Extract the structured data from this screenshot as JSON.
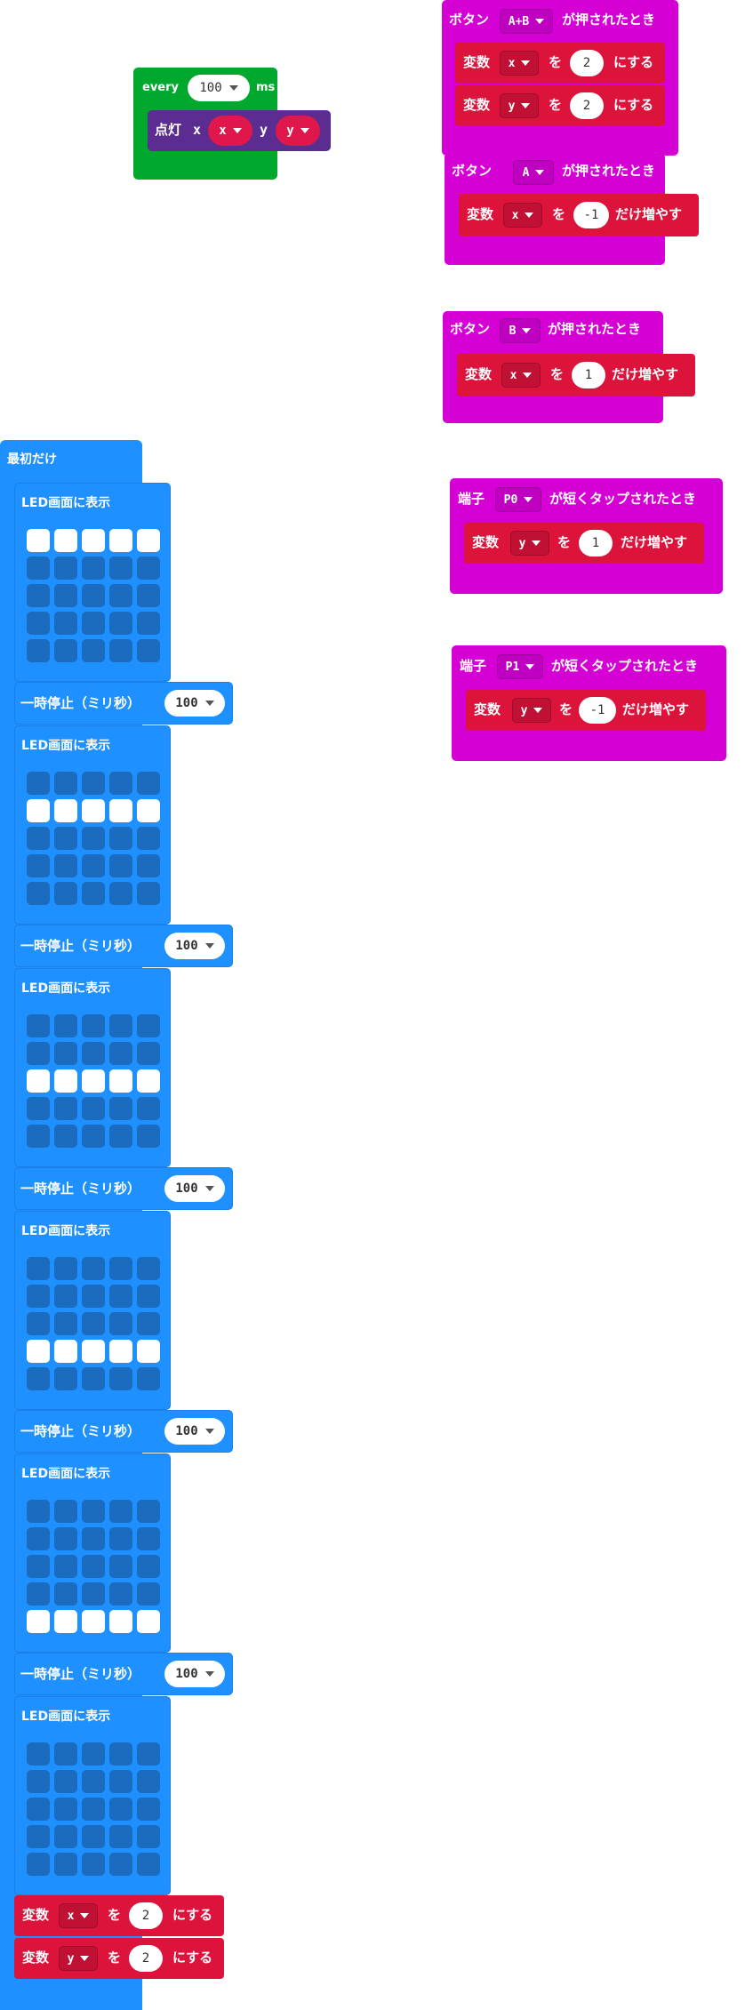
{
  "colors": {
    "loops": "#00a82d",
    "led": "#5c2d91",
    "led_var": "#e0174a",
    "input": "#d400d4",
    "variables": "#dc143c",
    "basic": "#1e90ff",
    "basic_dark": "#1b6bbe"
  },
  "every_block": {
    "label": "every",
    "interval": "100",
    "unit": "ms",
    "plot": {
      "label": "点灯",
      "x_label": "x",
      "x_var": "x",
      "y_label": "y",
      "y_var": "y"
    }
  },
  "on_button_ab": {
    "prefix": "ボタン",
    "button": "A+B",
    "suffix": "が押されたとき",
    "statements": [
      {
        "kw": "変数",
        "var": "x",
        "wo": "を",
        "value": "2",
        "action": "にする"
      },
      {
        "kw": "変数",
        "var": "y",
        "wo": "を",
        "value": "2",
        "action": "にする"
      }
    ]
  },
  "on_button_a": {
    "prefix": "ボタン",
    "button": "A",
    "suffix": "が押されたとき",
    "statements": [
      {
        "kw": "変数",
        "var": "x",
        "wo": "を",
        "value": "-1",
        "action": "だけ増やす"
      }
    ]
  },
  "on_button_b": {
    "prefix": "ボタン",
    "button": "B",
    "suffix": "が押されたとき",
    "statements": [
      {
        "kw": "変数",
        "var": "x",
        "wo": "を",
        "value": "1",
        "action": "だけ増やす"
      }
    ]
  },
  "on_pin_p0": {
    "prefix": "端子",
    "pin": "P0",
    "suffix": "が短くタップされたとき",
    "statements": [
      {
        "kw": "変数",
        "var": "y",
        "wo": "を",
        "value": "1",
        "action": "だけ増やす"
      }
    ]
  },
  "on_pin_p1": {
    "prefix": "端子",
    "pin": "P1",
    "suffix": "が短くタップされたとき",
    "statements": [
      {
        "kw": "変数",
        "var": "y",
        "wo": "を",
        "value": "-1",
        "action": "だけ増やす"
      }
    ]
  },
  "on_start": {
    "label": "最初だけ",
    "show_leds_label": "LED画面に表示",
    "pause_label": "一時停止（ミリ秒）",
    "pause_value": "100",
    "frames": [
      [
        [
          1,
          1,
          1,
          1,
          1
        ],
        [
          0,
          0,
          0,
          0,
          0
        ],
        [
          0,
          0,
          0,
          0,
          0
        ],
        [
          0,
          0,
          0,
          0,
          0
        ],
        [
          0,
          0,
          0,
          0,
          0
        ]
      ],
      [
        [
          0,
          0,
          0,
          0,
          0
        ],
        [
          1,
          1,
          1,
          1,
          1
        ],
        [
          0,
          0,
          0,
          0,
          0
        ],
        [
          0,
          0,
          0,
          0,
          0
        ],
        [
          0,
          0,
          0,
          0,
          0
        ]
      ],
      [
        [
          0,
          0,
          0,
          0,
          0
        ],
        [
          0,
          0,
          0,
          0,
          0
        ],
        [
          1,
          1,
          1,
          1,
          1
        ],
        [
          0,
          0,
          0,
          0,
          0
        ],
        [
          0,
          0,
          0,
          0,
          0
        ]
      ],
      [
        [
          0,
          0,
          0,
          0,
          0
        ],
        [
          0,
          0,
          0,
          0,
          0
        ],
        [
          0,
          0,
          0,
          0,
          0
        ],
        [
          1,
          1,
          1,
          1,
          1
        ],
        [
          0,
          0,
          0,
          0,
          0
        ]
      ],
      [
        [
          0,
          0,
          0,
          0,
          0
        ],
        [
          0,
          0,
          0,
          0,
          0
        ],
        [
          0,
          0,
          0,
          0,
          0
        ],
        [
          0,
          0,
          0,
          0,
          0
        ],
        [
          1,
          1,
          1,
          1,
          1
        ]
      ],
      [
        [
          0,
          0,
          0,
          0,
          0
        ],
        [
          0,
          0,
          0,
          0,
          0
        ],
        [
          0,
          0,
          0,
          0,
          0
        ],
        [
          0,
          0,
          0,
          0,
          0
        ],
        [
          0,
          0,
          0,
          0,
          0
        ]
      ]
    ],
    "set_statements": [
      {
        "kw": "変数",
        "var": "x",
        "wo": "を",
        "value": "2",
        "action": "にする"
      },
      {
        "kw": "変数",
        "var": "y",
        "wo": "を",
        "value": "2",
        "action": "にする"
      }
    ]
  }
}
